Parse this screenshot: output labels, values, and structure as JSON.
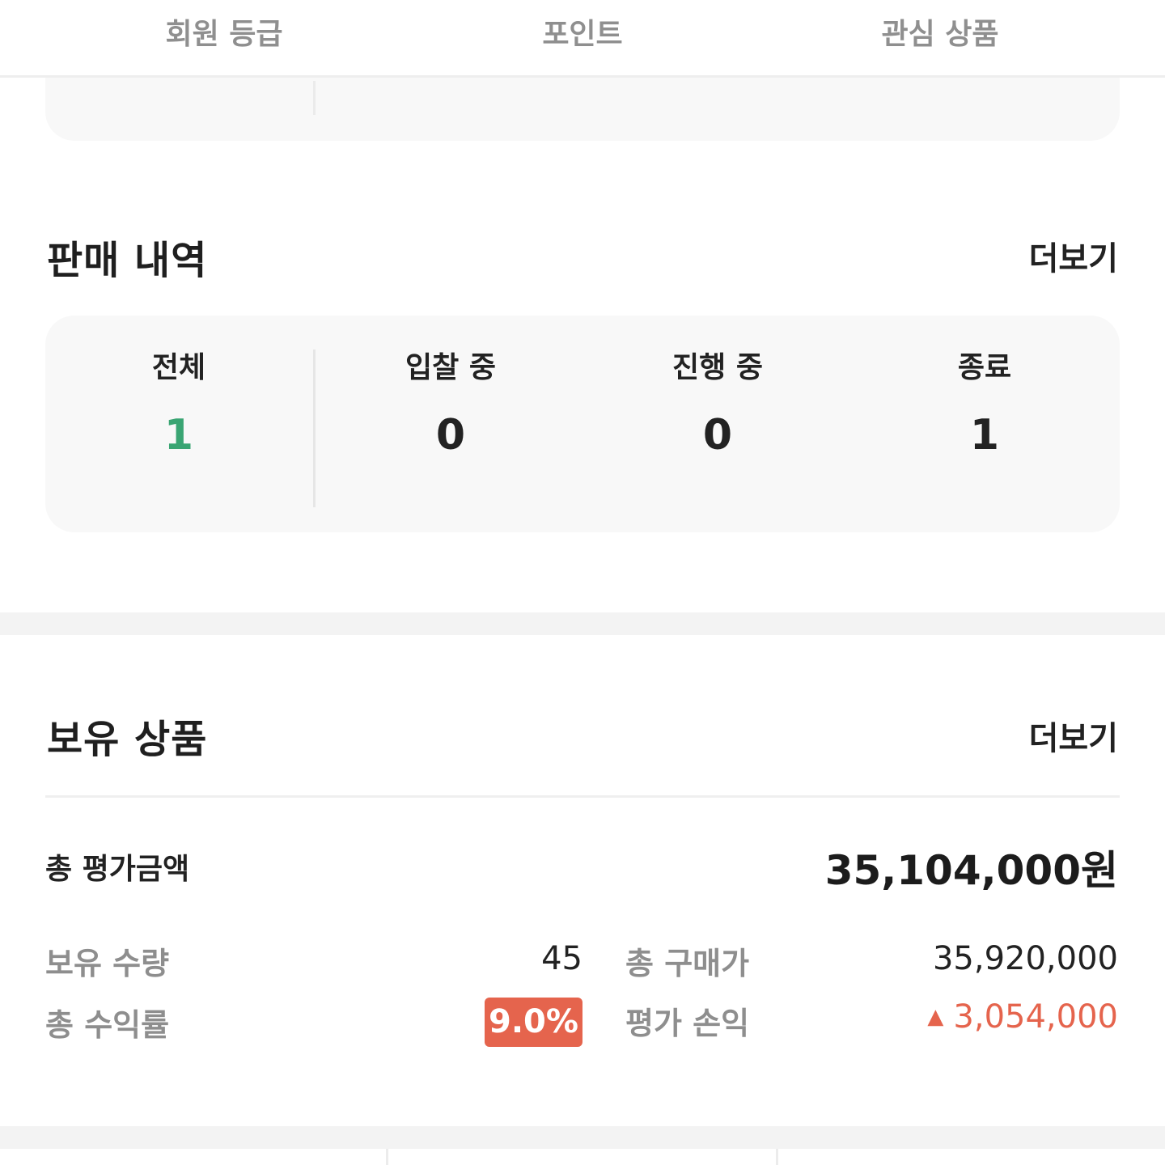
{
  "top_tabs": [
    "회원 등급",
    "포인트",
    "관심 상품"
  ],
  "sales": {
    "title": "판매 내역",
    "more": "더보기",
    "stats": [
      {
        "label": "전체",
        "value": "1"
      },
      {
        "label": "입찰 중",
        "value": "0"
      },
      {
        "label": "진행 중",
        "value": "0"
      },
      {
        "label": "종료",
        "value": "1"
      }
    ],
    "active_color": "#3aa573"
  },
  "holdings": {
    "title": "보유 상품",
    "more": "더보기",
    "total_label": "총 평가금액",
    "total_value": "35,104,000원",
    "quantity_label": "보유 수량",
    "quantity_value": "45",
    "purchase_label": "총 구매가",
    "purchase_value": "35,920,000",
    "return_label": "총 수익률",
    "return_value": "9.0%",
    "pl_label": "평가 손익",
    "pl_arrow": "▲",
    "pl_value": "3,054,000",
    "accent_color": "#e5644d"
  }
}
